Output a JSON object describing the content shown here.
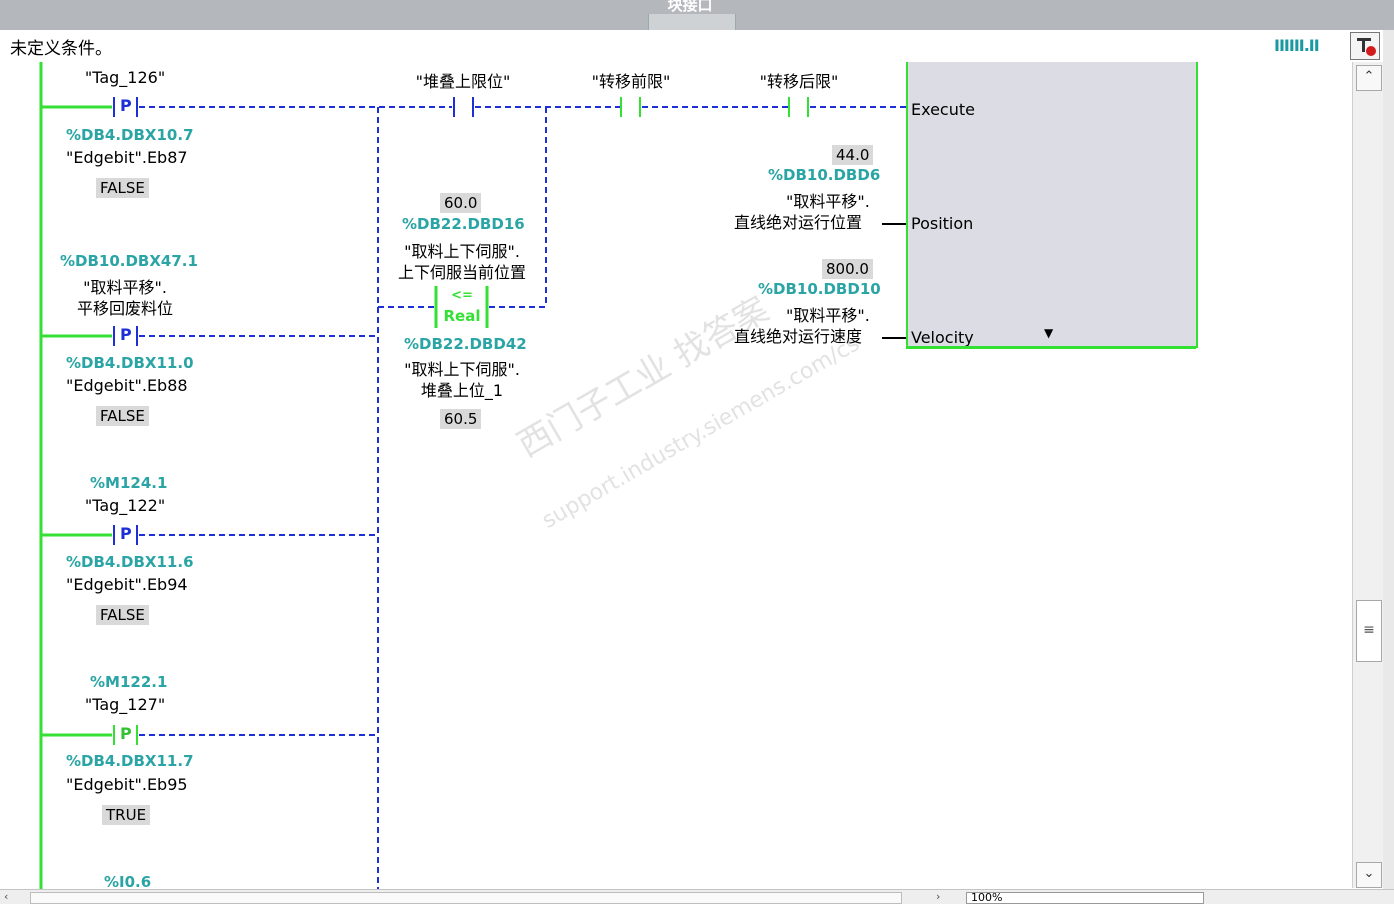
{
  "window": {
    "title": "块接口"
  },
  "status": {
    "text": "未定义条件。"
  },
  "colors": {
    "rail_green": "#33e033",
    "wire_blue": "#1d2fd6",
    "address_teal": "#2aa4a4",
    "value_bg": "#d9d9d9",
    "block_bg": "#dcdce4"
  },
  "icons": {
    "bars": "IIIIII.II",
    "toggle": "network-toggle-icon"
  },
  "contacts": {
    "c1": {
      "tag": "\"Tag_126\"",
      "type": "P",
      "addr": "%DB4.DBX10.7",
      "edge": "\"Edgebit\".Eb87",
      "state": "FALSE"
    },
    "c2": {
      "addr_top": "%DB10.DBX47.1",
      "tag1": "\"取料平移\".",
      "tag2": "平移回废料位",
      "type": "P",
      "addr": "%DB4.DBX11.0",
      "edge": "\"Edgebit\".Eb88",
      "state": "FALSE"
    },
    "c3": {
      "addr_top": "%M124.1",
      "tag": "\"Tag_122\"",
      "type": "P",
      "addr": "%DB4.DBX11.6",
      "edge": "\"Edgebit\".Eb94",
      "state": "FALSE"
    },
    "c4": {
      "addr_top": "%M122.1",
      "tag": "\"Tag_127\"",
      "type": "P",
      "addr": "%DB4.DBX11.7",
      "edge": "\"Edgebit\".Eb95",
      "state": "TRUE"
    },
    "c5": {
      "addr_top": "%I0.6"
    }
  },
  "series_contacts": {
    "stack_upper": "\"堆叠上限位\"",
    "move_front": "\"转移前限\"",
    "move_back": "\"转移后限\""
  },
  "compare": {
    "in1_value": "60.0",
    "in1_addr": "%DB22.DBD16",
    "in1_tag1": "\"取料上下伺服\".",
    "in1_tag2": "上下伺服当前位置",
    "op": "<=",
    "type": "Real",
    "in2_addr": "%DB22.DBD42",
    "in2_tag1": "\"取料上下伺服\".",
    "in2_tag2": "堆叠上位_1",
    "in2_value": "60.5"
  },
  "block": {
    "execute": "Execute",
    "position_label": "Position",
    "velocity_label": "Velocity",
    "pos_value": "44.0",
    "pos_addr": "%DB10.DBD6",
    "pos_tag1": "\"取料平移\".",
    "pos_tag2": "直线绝对运行位置",
    "vel_value": "800.0",
    "vel_addr": "%DB10.DBD10",
    "vel_tag1": "\"取料平移\".",
    "vel_tag2": "直线绝对运行速度"
  },
  "bottom": {
    "zoom": "100%"
  },
  "watermark": {
    "line1": "西门子工业  找答案",
    "line2": "support.industry.siemens.com/cs"
  }
}
